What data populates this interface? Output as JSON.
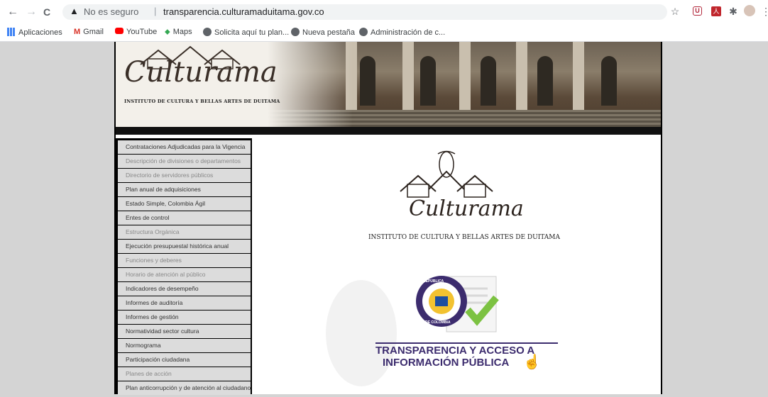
{
  "browser": {
    "nav": {
      "back": "←",
      "forward": "→",
      "reload": "C"
    },
    "security_label": "No es seguro",
    "url": "transparencia.culturamaduitama.gov.co"
  },
  "bookmarks": [
    {
      "label": "Aplicaciones",
      "icon": "apps-grid-icon"
    },
    {
      "label": "Gmail",
      "icon": "gmail-icon"
    },
    {
      "label": "YouTube",
      "icon": "youtube-icon"
    },
    {
      "label": "Maps",
      "icon": "maps-pin-icon"
    },
    {
      "label": "Solicita aquí tu plan...",
      "icon": "globe-icon"
    },
    {
      "label": "Nueva pestaña",
      "icon": "globe-icon"
    },
    {
      "label": "Administración de c...",
      "icon": "globe-icon"
    }
  ],
  "banner": {
    "logo_text": "Culturama",
    "subtitle": "INSTITUTO DE CULTURA Y BELLAS ARTES DE DUITAMA"
  },
  "menu": [
    {
      "label": "Contrataciones Adjudicadas para la Vigencia",
      "dim": false
    },
    {
      "label": "Descripción de divisiones o departamentos",
      "dim": true
    },
    {
      "label": "Directorio de servidores públicos",
      "dim": true
    },
    {
      "label": "Plan anual de adquisiciones",
      "dim": false
    },
    {
      "label": "Estado Simple, Colombia Ágil",
      "dim": false
    },
    {
      "label": "Entes de control",
      "dim": false
    },
    {
      "label": "Estructura Orgánica",
      "dim": true
    },
    {
      "label": "Ejecución presupuestal histórica anual",
      "dim": false
    },
    {
      "label": "Funciones y deberes",
      "dim": true
    },
    {
      "label": "Horario de atención al público",
      "dim": true
    },
    {
      "label": "Indicadores de desempeño",
      "dim": false
    },
    {
      "label": "Informes de auditoría",
      "dim": false
    },
    {
      "label": "Informes de gestión",
      "dim": false
    },
    {
      "label": "Normatividad sector cultura",
      "dim": false
    },
    {
      "label": "Normograma",
      "dim": false
    },
    {
      "label": "Participación ciudadana",
      "dim": false
    },
    {
      "label": "Planes de acción",
      "dim": true
    },
    {
      "label": "Plan anticorrupción y de atención al ciudadano",
      "dim": false
    }
  ],
  "content": {
    "logo_text": "Culturama",
    "institute": "INSTITUTO DE CULTURA Y BELLAS ARTES DE DUITAMA",
    "seal_text_top": "REPÚBLICA",
    "seal_text_bottom": "DE COLOMBIA",
    "transparency_line1": "TRANSPARENCIA Y ACCESO A",
    "transparency_line2": "INFORMACIÓN PÚBLICA"
  },
  "colors": {
    "accent_purple": "#3c2c6e",
    "check_green": "#7cc242",
    "sidebar_bg": "#000000"
  }
}
